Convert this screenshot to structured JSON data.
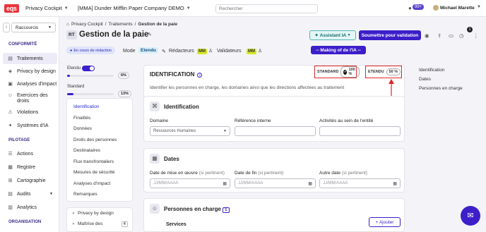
{
  "topbar": {
    "logo": "eqs",
    "app_menu": "Privacy Cockpit",
    "company_menu": "[MMA] Dunder Mifflin Paper Company DEMO",
    "search_placeholder": "Rechercher",
    "badge": "99+",
    "user_name": "Michael Marette"
  },
  "sidebar": {
    "shortcut_label": "Raccourcis",
    "section_conformite": "CONFORMITÉ",
    "conformite_items": [
      {
        "label": "Traitements",
        "icon": "document-icon"
      },
      {
        "label": "Privacy by design",
        "icon": "shield-icon"
      },
      {
        "label": "Analyses d'impact",
        "icon": "chart-icon"
      },
      {
        "label": "Exercices des droits",
        "icon": "user-check-icon"
      },
      {
        "label": "Violations",
        "icon": "alert-icon"
      },
      {
        "label": "Systèmes d'IA",
        "icon": "ai-icon"
      }
    ],
    "section_pilotage": "PILOTAGE",
    "pilotage_items": [
      {
        "label": "Actions",
        "icon": "list-icon"
      },
      {
        "label": "Registre",
        "icon": "book-icon"
      },
      {
        "label": "Cartographie",
        "icon": "map-icon"
      },
      {
        "label": "Audits",
        "icon": "audit-icon"
      },
      {
        "label": "Analytics",
        "icon": "analytics-icon"
      }
    ],
    "section_organisation": "ORGANISATION"
  },
  "header": {
    "breadcrumb": [
      "Privacy Cockpit",
      "/",
      "Traitements",
      "/",
      "Gestion de la paie"
    ],
    "code": "RT",
    "title": "Gestion de la paie",
    "btn_ai": "Assistant IA",
    "btn_submit": "Soumettre pour validation",
    "notif_count": "1",
    "status": "En cours de rédaction",
    "mode_label": "Mode",
    "mode_value": "Etendu",
    "redacteurs_label": "Rédacteurs",
    "validateurs_label": "Validateurs",
    "initials": "MM",
    "btn_making": "-- Making of de l'IA --"
  },
  "levels": {
    "etendu_label": "Etendu",
    "etendu_pct": "6%",
    "etendu_value": 0.06,
    "standard_label": "Standard",
    "standard_pct": "13%",
    "standard_value": 0.13
  },
  "subnav": [
    "Identification",
    "Finalités",
    "Données",
    "Droits des personnes",
    "Destinataires",
    "Flux transfrontaliers",
    "Mesures de sécurité",
    "Analyses d'impact",
    "Remarques"
  ],
  "subnav2": [
    {
      "label": "Privacy by design",
      "count": ""
    },
    {
      "label": "Maîtrise des",
      "count": "4"
    }
  ],
  "identification_card": {
    "title": "IDENTIFICATION",
    "standard_label": "STANDARD",
    "standard_pct": "100 %",
    "etendu_label": "ETENDU",
    "etendu_pct": "50 %",
    "description": "Identifier les personnes en charge, les domaines ainsi que les directions affectées au traitement"
  },
  "identification_section": {
    "title": "Identification",
    "domaine_label": "Domaine",
    "domaine_value": "Ressources Humaines",
    "ref_label": "Référence interne",
    "activites_label": "Activités au sein de l'entité"
  },
  "dates_section": {
    "title": "Dates",
    "mise_label": "Date de mise en œuvre",
    "fin_label": "Date de fin",
    "autre_label": "Autre date",
    "optional": "(si pertinent)",
    "placeholder": "JJ/MM/AAAA"
  },
  "personnes_section": {
    "title": "Personnes en charge",
    "count": "1",
    "add_label": "+ Ajouter",
    "services_label": "Services"
  },
  "toc": [
    "Identification",
    "Dates",
    "Personnes en charge"
  ],
  "colors": {
    "accent": "#3c1fc9",
    "brand_red": "#e8333a",
    "highlight": "#e02626"
  }
}
